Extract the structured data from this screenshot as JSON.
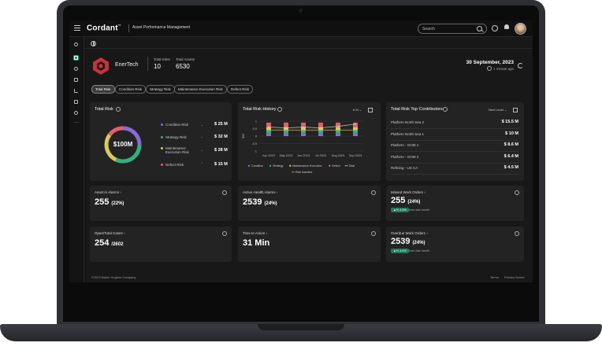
{
  "header": {
    "logo": "Cordant",
    "logo_tm": "™",
    "app_title": "Asset Performance Management",
    "search_placeholder": "Search"
  },
  "org": {
    "name": "EnerTech",
    "total_sites_label": "Total Sites",
    "total_sites_value": "10",
    "total_assets_label": "Total Assets",
    "total_assets_value": "6530",
    "date": "30 September, 2023",
    "updated": "1 minute ago"
  },
  "filters": [
    "Total Risk",
    "Condition Risk",
    "Strategy Risk",
    "Maintenance Execution Risk",
    "Defect Risk"
  ],
  "total_risk": {
    "title": "Total Risk",
    "center": "$100M",
    "rows": [
      {
        "label": "Condition Risk",
        "value": "$ 25 M",
        "color": "#8a6ad6"
      },
      {
        "label": "Strategy Risk",
        "value": "$ 32 M",
        "color": "#2fb37a"
      },
      {
        "label": "Maintenance",
        "label2": "Execution Risk",
        "value": "$ 28 M",
        "color": "#d9c95a"
      },
      {
        "label": "Defect Risk",
        "value": "$ 15 M",
        "color": "#e0606a"
      }
    ]
  },
  "risk_history": {
    "title": "Total Risk History",
    "range": "6 M",
    "y_unit": "$M"
  },
  "chart_data": {
    "type": "bar",
    "title": "Total Risk History",
    "categories": [
      "Apr 2023",
      "May 2023",
      "Jun 2023",
      "Jul 2023",
      "Aug 2023",
      "Sep 2023"
    ],
    "y_ticks": [
      "1",
      "0.5",
      "0",
      "-0.5",
      "-1"
    ],
    "ylabel": "$M",
    "series": [
      {
        "name": "Condition",
        "color": "#8a6ad6",
        "values": [
          0.2,
          0.2,
          0.2,
          0.2,
          0.2,
          0.2
        ]
      },
      {
        "name": "Strategy",
        "color": "#2fb37a",
        "values": [
          0.2,
          0.2,
          0.2,
          0.2,
          0.2,
          0.2
        ]
      },
      {
        "name": "Maintenance Execution",
        "color": "#d9c95a",
        "values": [
          0.2,
          0.2,
          0.2,
          0.2,
          0.2,
          0.2
        ]
      },
      {
        "name": "Defect",
        "color": "#e0606a",
        "values": [
          0.3,
          0.3,
          0.3,
          0.3,
          0.3,
          0.3
        ]
      }
    ],
    "lines": [
      {
        "name": "Total",
        "color": "#cfcfcf",
        "values": [
          0.6,
          0.55,
          0.6,
          0.55,
          0.65,
          0.8
        ]
      },
      {
        "name": "Risk baseline",
        "color": "#d9a94a",
        "values": [
          0.4,
          0.4,
          0.4,
          0.4,
          0.4,
          0.4
        ]
      }
    ],
    "ylim": [
      -1,
      1
    ],
    "legend": "bottom"
  },
  "top_contributors": {
    "title": "Total Risk Top Contributors",
    "level": "Next Level",
    "rows": [
      {
        "name": "Platform North Sea 2",
        "value": "$ 15.5 M"
      },
      {
        "name": "Platform North Sea 1",
        "value": "$ 10 M"
      },
      {
        "name": "Platform - GOM 1",
        "value": "$ 8.6 M"
      },
      {
        "name": "Platform - GOM 2",
        "value": "$ 6.4 M"
      },
      {
        "name": "Refining - US CA",
        "value": "$ 4.5 M"
      }
    ]
  },
  "kpis": [
    {
      "title": "Asset in Alarms",
      "value": "255",
      "suffix": "(22%)"
    },
    {
      "title": "Active Health Alarms",
      "value": "2539",
      "suffix": "(24%)"
    },
    {
      "title": "Missed Work Orders",
      "value": "255",
      "suffix": "(24%)",
      "delta": "▲% 4.6%",
      "note": "from last month"
    },
    {
      "title": "Open/Total Cases",
      "value": "254",
      "suffix": "/2602"
    },
    {
      "title": "Time to Action",
      "value": "31 Min",
      "suffix": ""
    },
    {
      "title": "Overdue Work Orders",
      "value": "2539",
      "suffix": "(24%)",
      "delta": "▲% 4.6%",
      "note": "from last month"
    }
  ],
  "footer": {
    "copyright": "©2023 Baker Hughes Company",
    "terms": "Terms",
    "privacy": "Privacy Notice"
  }
}
